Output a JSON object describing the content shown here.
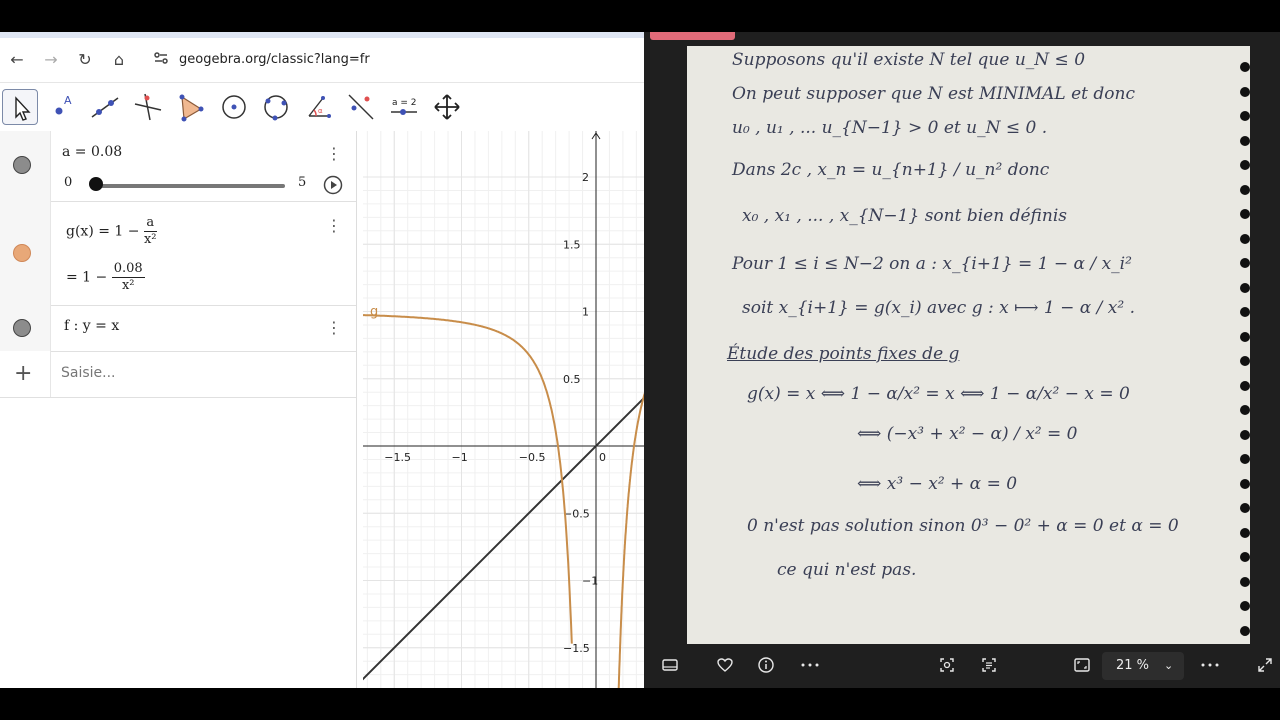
{
  "browser": {
    "url": "geogebra.org/classic?lang=fr",
    "nav": {
      "back": "←",
      "forward": "→",
      "reload": "↻",
      "home": "⌂"
    }
  },
  "toolbar": {
    "tools": [
      "move",
      "point",
      "line",
      "perpendicular",
      "polygon",
      "circle",
      "circle-3pts",
      "angle",
      "reflect",
      "slider",
      "move-view"
    ],
    "slider_tool_label": "a = 2"
  },
  "algebra": {
    "row1": {
      "expr": "a = 0.08",
      "slider_min": "0",
      "slider_max": "5",
      "slider_value": 0.016
    },
    "row2": {
      "lhs": "g(x) = 1 −",
      "num": "a",
      "den": "x²",
      "eq": "= 1 −",
      "num2": "0.08",
      "den2": "x²"
    },
    "row3": {
      "expr": "f : y = x"
    },
    "input_placeholder": "Saisie...",
    "menu_glyph": "⋮",
    "add_glyph": "+"
  },
  "graph": {
    "x_ticks": [
      "−1.5",
      "−1",
      "−0.5",
      "0"
    ],
    "y_ticks": [
      "2",
      "1.5",
      "1",
      "0.5",
      "−0.5",
      "−1",
      "−1.5"
    ],
    "curve_label": "g",
    "colors": {
      "curve": "#c88d4a",
      "line": "#333333",
      "grid": "#e4e4e4",
      "axis": "#222222"
    }
  },
  "colors": {
    "dot_gray": "#8c8c8c",
    "dot_orange": "#e8a878",
    "accent_pink": "#e06a78"
  },
  "photo": {
    "lines": [
      "Supposons qu'il existe N tel que u_N ≤ 0",
      "On peut supposer que N est MINIMAL et donc",
      "u₀ , u₁ , ... u_{N−1} > 0   et   u_N ≤ 0 .",
      "Dans 2c ,   x_n = u_{n+1} / u_n²    donc",
      "x₀ , x₁ , ... , x_{N−1}  sont bien définis",
      "Pour 1 ≤ i ≤ N−2   on a :   x_{i+1} = 1 − α / x_i²",
      "soit   x_{i+1} = g(x_i)   avec  g : x ⟼ 1 − α / x² .",
      "Étude des points fixes de g",
      "g(x) = x   ⟺   1 − α/x² = x   ⟺   1 − α/x² − x = 0",
      "⟺   (−x³ + x² − α) / x² = 0",
      "⟺   x³ − x² + α = 0",
      "0 n'est pas solution sinon  0³ − 0² + α = 0   et  α = 0",
      "ce qui n'est pas."
    ],
    "zoom": "21 %",
    "icons": [
      "slideshow-icon",
      "heart-icon",
      "info-icon",
      "more-icon",
      "crop-icon",
      "text-scan-icon",
      "fit-icon",
      "zoom-menu",
      "more-icon",
      "expand-icon"
    ]
  }
}
